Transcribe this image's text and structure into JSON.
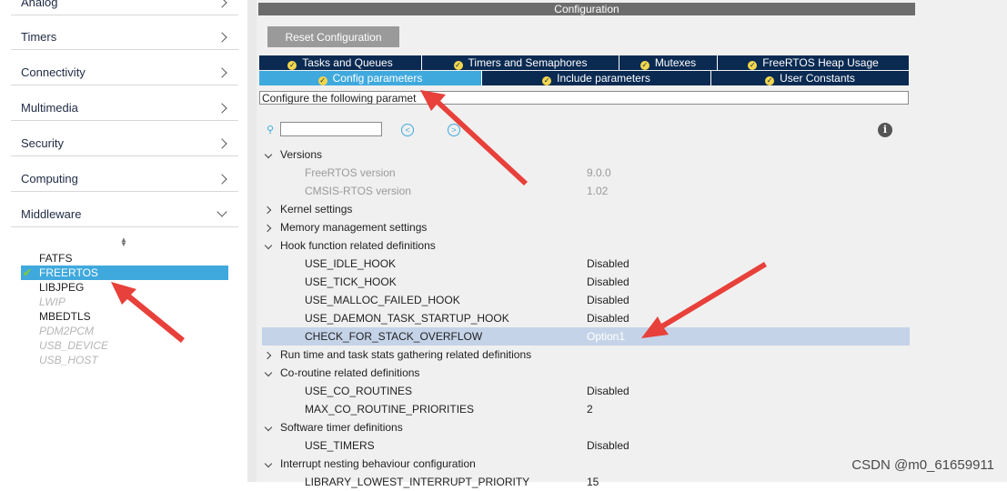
{
  "sidebar": {
    "categories": [
      {
        "label": "Analog"
      },
      {
        "label": "Timers"
      },
      {
        "label": "Connectivity"
      },
      {
        "label": "Multimedia"
      },
      {
        "label": "Security"
      },
      {
        "label": "Computing"
      },
      {
        "label": "Middleware"
      }
    ],
    "middleware_items": [
      {
        "label": "FATFS",
        "state": "normal"
      },
      {
        "label": "FREERTOS",
        "state": "selected"
      },
      {
        "label": "LIBJPEG",
        "state": "normal"
      },
      {
        "label": "LWIP",
        "state": "disabled"
      },
      {
        "label": "MBEDTLS",
        "state": "normal"
      },
      {
        "label": "PDM2PCM",
        "state": "disabled"
      },
      {
        "label": "USB_DEVICE",
        "state": "disabled"
      },
      {
        "label": "USB_HOST",
        "state": "disabled"
      }
    ]
  },
  "config": {
    "title": "Configuration",
    "reset_label": "Reset Configuration",
    "tabs_row1": [
      {
        "label": "Tasks and Queues"
      },
      {
        "label": "Timers and Semaphores"
      },
      {
        "label": "Mutexes"
      },
      {
        "label": "FreeRTOS Heap Usage"
      }
    ],
    "tabs_row2": [
      {
        "label": "Config parameters",
        "active": true
      },
      {
        "label": "Include parameters"
      },
      {
        "label": "User Constants"
      }
    ],
    "description": "Configure the following paramet"
  },
  "tree": {
    "versions": "Versions",
    "freertos_version_label": "FreeRTOS version",
    "freertos_version_value": "9.0.0",
    "cmsis_version_label": "CMSIS-RTOS version",
    "cmsis_version_value": "1.02",
    "kernel": "Kernel settings",
    "memory": "Memory management settings",
    "hook": "Hook function related definitions",
    "idle_hook": "USE_IDLE_HOOK",
    "tick_hook": "USE_TICK_HOOK",
    "malloc_hook": "USE_MALLOC_FAILED_HOOK",
    "daemon_hook": "USE_DAEMON_TASK_STARTUP_HOOK",
    "stack_overflow": "CHECK_FOR_STACK_OVERFLOW",
    "stack_overflow_value": "Option1",
    "runtime": "Run time and task stats gathering related definitions",
    "coroutine": "Co-routine related definitions",
    "use_co": "USE_CO_ROUTINES",
    "max_co": "MAX_CO_ROUTINE_PRIORITIES",
    "max_co_value": "2",
    "timer": "Software timer definitions",
    "use_timers": "USE_TIMERS",
    "interrupt": "Interrupt nesting behaviour configuration",
    "lowest_irq": "LIBRARY_LOWEST_INTERRUPT_PRIORITY",
    "lowest_irq_value": "15",
    "disabled": "Disabled"
  },
  "watermark": "CSDN @m0_61659911",
  "colors": {
    "accent": "#3fa9de",
    "tab_bg": "#0a2a52",
    "arrow": "#e8403a"
  }
}
